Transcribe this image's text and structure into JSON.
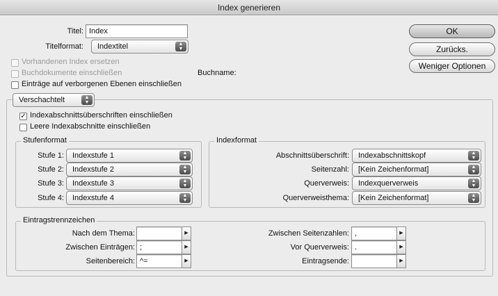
{
  "window": {
    "title": "Index generieren"
  },
  "titel": {
    "label": "Titel:",
    "value": "Index"
  },
  "titelformat": {
    "label": "Titelformat:",
    "value": "Indextitel"
  },
  "options": {
    "vorhandenen": "Vorhandenen Index ersetzen",
    "buchdokumente": "Buchdokumente einschließen",
    "buchname_label": "Buchname:",
    "eintraege": "Einträge auf verborgenen Ebenen einschließen"
  },
  "buttons": {
    "ok": "OK",
    "back": "Zurücks.",
    "fewer": "Weniger Optionen"
  },
  "structure": {
    "value": "Verschachtelt"
  },
  "checks": {
    "sections": "Indexabschnittsüberschriften einschließen",
    "sections_checked_mark": "✓",
    "empty": "Leere Indexabschnitte einschließen"
  },
  "stufenformat": {
    "legend": "Stufenformat",
    "levels": [
      {
        "label": "Stufe 1:",
        "value": "Indexstufe 1"
      },
      {
        "label": "Stufe 2:",
        "value": "Indexstufe 2"
      },
      {
        "label": "Stufe 3:",
        "value": "Indexstufe 3"
      },
      {
        "label": "Stufe 4:",
        "value": "Indexstufe 4"
      }
    ]
  },
  "indexformat": {
    "legend": "Indexformat",
    "rows": [
      {
        "label": "Abschnittsüberschrift:",
        "value": "Indexabschnittskopf"
      },
      {
        "label": "Seitenzahl:",
        "value": "[Kein Zeichenformat]"
      },
      {
        "label": "Querverweis:",
        "value": "Indexquerverweis"
      },
      {
        "label": "Querverweisthema:",
        "value": "[Kein Zeichenformat]"
      }
    ]
  },
  "eintragstrennzeichen": {
    "legend": "Eintragstrennzeichen",
    "left": [
      {
        "label": "Nach dem Thema:",
        "value": ""
      },
      {
        "label": "Zwischen Einträgen:",
        "value": ";"
      },
      {
        "label": "Seitenbereich:",
        "value": "^="
      }
    ],
    "right": [
      {
        "label": "Zwischen Seitenzahlen:",
        "value": ","
      },
      {
        "label": "Vor Querverweis:",
        "value": "."
      },
      {
        "label": "Eintragsende:",
        "value": ""
      }
    ]
  },
  "icons": {
    "popup_arrows": "▲▼",
    "field_arrow": "▶"
  }
}
